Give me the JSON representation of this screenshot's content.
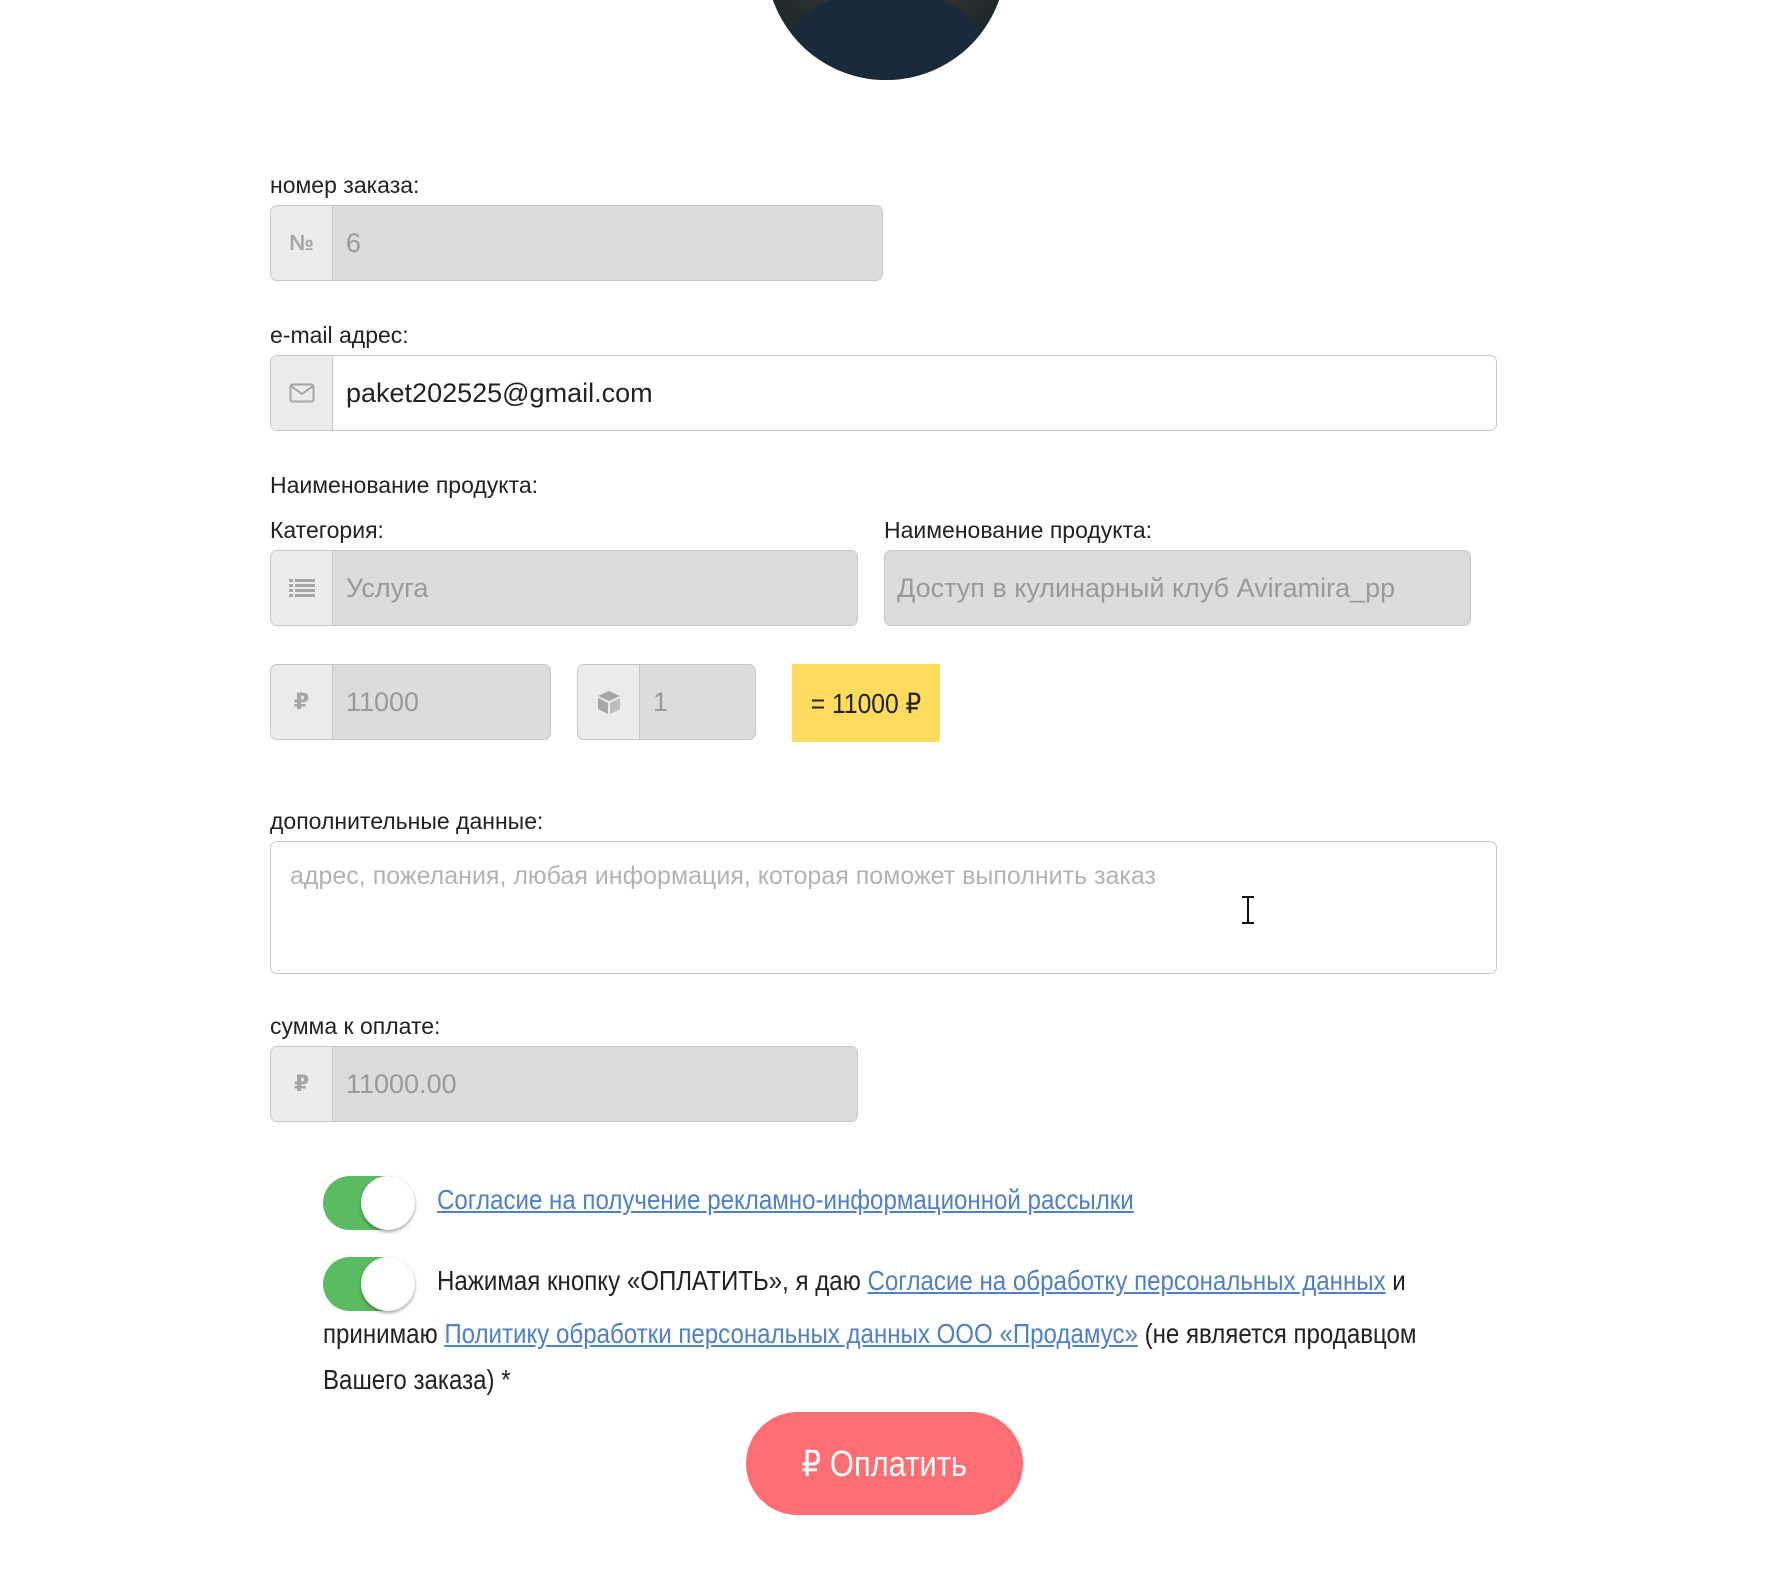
{
  "order": {
    "label": "номер заказа:",
    "prefix": "№",
    "value": "6"
  },
  "email": {
    "label": "e-mail адрес:",
    "icon": "envelope-icon",
    "value": "paket202525@gmail.com"
  },
  "product": {
    "section_label": "Наименование продукта:",
    "category_label": "Категория:",
    "category_icon": "list-icon",
    "category_value": "Услуга",
    "name_label": "Наименование продукта:",
    "name_value": "Доступ в кулинарный клуб Aviramira_pp"
  },
  "pricing": {
    "price_prefix": "₽",
    "price_value": "11000",
    "quantity_icon": "box-icon",
    "quantity_value": "1",
    "total": "= 11000 ₽",
    "total_color": "#ffdb5e"
  },
  "extra": {
    "label": "дополнительные данные:",
    "placeholder": "адрес, пожелания, любая информация, которая поможет выполнить заказ"
  },
  "amount": {
    "label": "сумма к оплате:",
    "prefix": "₽",
    "value": "11000.00"
  },
  "consents": {
    "toggle_color": "#5bbb61",
    "newsletter_link": "Согласие на получение рекламно-информационной рассылки",
    "personal_text_1": "Нажимая кнопку «ОПЛАТИТЬ», я даю ",
    "personal_link_1": "Согласие на обработку персональных данных",
    "personal_text_2": " и",
    "personal_text_3": "принимаю ",
    "personal_link_2": "Политику обработки персональных данных ООО «Продамус»",
    "personal_text_4": " (не является продавцом",
    "personal_text_5": "Вашего заказа) *",
    "link_color": "#4f80c1"
  },
  "pay_button": {
    "label": "₽ Оплатить",
    "color": "#fe6e73"
  }
}
